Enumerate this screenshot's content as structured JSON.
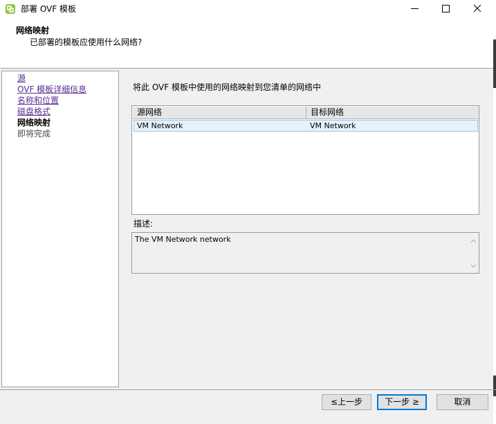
{
  "window": {
    "title": "部署 OVF 模板",
    "icons": {
      "app": "vsphere-deploy-icon",
      "minimize": "minimize-icon",
      "maximize": "maximize-icon",
      "close": "close-icon"
    }
  },
  "header": {
    "title": "网络映射",
    "subtitle": "已部署的模板应使用什么网络?"
  },
  "sidebar": {
    "steps": [
      {
        "label": "源",
        "state": "link"
      },
      {
        "label": "OVF 模板详细信息",
        "state": "link"
      },
      {
        "label": "名称和位置",
        "state": "link"
      },
      {
        "label": "磁盘格式",
        "state": "link"
      },
      {
        "label": "网络映射",
        "state": "current"
      },
      {
        "label": "即将完成",
        "state": "pending"
      }
    ]
  },
  "main": {
    "instruction": "将此 OVF 模板中使用的网络映射到您清单的网络中",
    "table": {
      "columns": [
        "源网络",
        "目标网络"
      ],
      "rows": [
        {
          "source": "VM Network",
          "destination": "VM Network",
          "selected": true
        }
      ]
    },
    "description_label": "描述:",
    "description_text": "The VM Network network"
  },
  "footer": {
    "back_label": "≤上一步",
    "next_label": "下一步 ≥",
    "cancel_label": "取消"
  },
  "colors": {
    "link": "#5a2d91",
    "selected_row": "#e5f1fb",
    "default_button_border": "#0078d7"
  }
}
